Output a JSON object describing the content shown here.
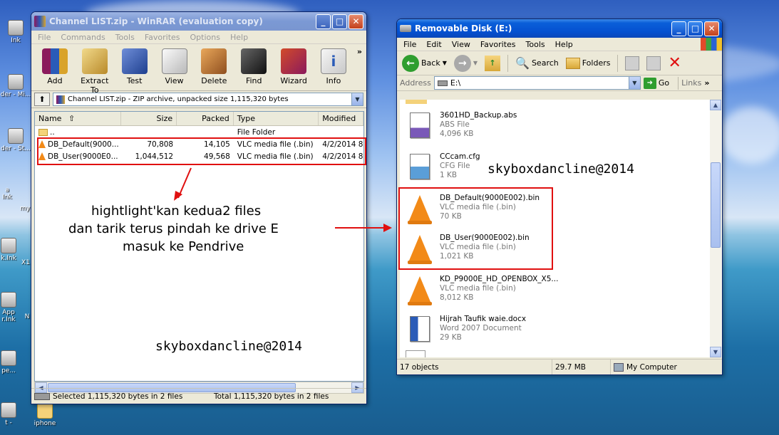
{
  "desktop": {
    "icons": [
      "Ink",
      "der - Mi...",
      "der - St...",
      "a Ink",
      "my",
      "k.Ink",
      "X1",
      "App r.Ink",
      "N",
      "pe...",
      "t -",
      "iphone"
    ]
  },
  "winrar": {
    "title": "Channel LIST.zip - WinRAR (evaluation copy)",
    "menu": [
      "File",
      "Commands",
      "Tools",
      "Favorites",
      "Options",
      "Help"
    ],
    "toolbar": [
      "Add",
      "Extract To",
      "Test",
      "View",
      "Delete",
      "Find",
      "Wizard",
      "Info"
    ],
    "more_chevron": "»",
    "address": "Channel LIST.zip - ZIP archive, unpacked size 1,115,320 bytes",
    "columns": [
      "Name",
      "Size",
      "Packed",
      "Type",
      "Modified"
    ],
    "rows": [
      {
        "name": "..",
        "size": "",
        "packed": "",
        "type": "File Folder",
        "modified": ""
      },
      {
        "name": "DB_Default(9000...",
        "size": "70,808",
        "packed": "14,105",
        "type": "VLC media file (.bin)",
        "modified": "4/2/2014 8"
      },
      {
        "name": "DB_User(9000E0...",
        "size": "1,044,512",
        "packed": "49,568",
        "type": "VLC media file (.bin)",
        "modified": "4/2/2014 8"
      }
    ],
    "status_left": "Selected 1,115,320 bytes in 2 files",
    "status_right": "Total 1,115,320 bytes in 2 files"
  },
  "explorer": {
    "title": "Removable Disk (E:)",
    "menu": [
      "File",
      "Edit",
      "View",
      "Favorites",
      "Tools",
      "Help"
    ],
    "toolbar": {
      "back": "Back",
      "search": "Search",
      "folders": "Folders"
    },
    "address_label": "Address",
    "address_value": "E:\\",
    "go": "Go",
    "links": "Links",
    "files": [
      {
        "name": "3601HD_Backup.abs",
        "type": "ABS File",
        "size": "4,096 KB"
      },
      {
        "name": "CCcam.cfg",
        "type": "CFG File",
        "size": "1 KB"
      },
      {
        "name": "DB_Default(9000E002).bin",
        "type": "VLC media file (.bin)",
        "size": "70 KB"
      },
      {
        "name": "DB_User(9000E002).bin",
        "type": "VLC media file (.bin)",
        "size": "1,021 KB"
      },
      {
        "name": "KD_P9000E_HD_OPENBOX_X5...",
        "type": "VLC media file (.bin)",
        "size": "8,012 KB"
      },
      {
        "name": "Hijrah Taufik waie.docx",
        "type": "Word 2007 Document",
        "size": "29 KB"
      }
    ],
    "status_objects": "17 objects",
    "status_size": "29.7 MB",
    "status_location": "My Computer"
  },
  "annotations": {
    "instruction_line1": "hightlight'kan kedua2 files",
    "instruction_line2": "dan tarik terus pindah ke drive E",
    "instruction_line3": "masuk ke Pendrive",
    "watermark1": "skyboxdancline@2014",
    "watermark2": "skyboxdancline@2014"
  },
  "colors": {
    "annotation_red": "#e01010",
    "xp_blue": "#0a5fd9",
    "vlc_orange": "#f28a18"
  }
}
